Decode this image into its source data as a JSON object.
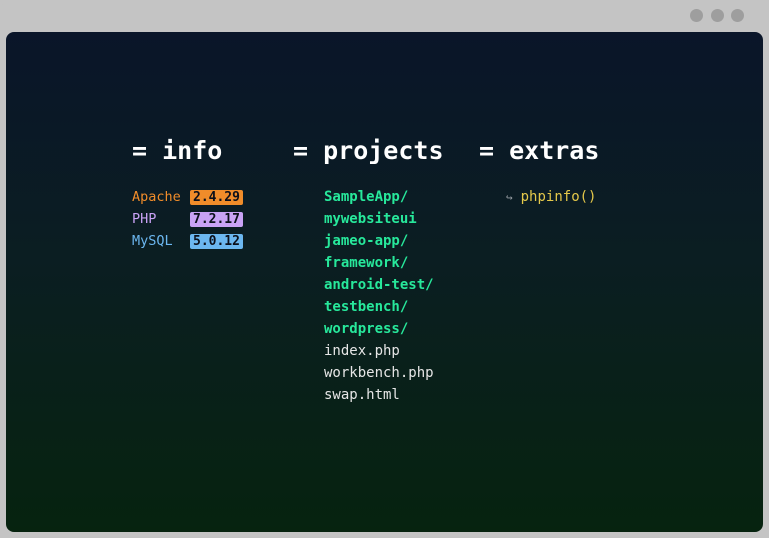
{
  "info": {
    "heading": "= info",
    "items": [
      {
        "name": "Apache",
        "version": "2.4.29",
        "color": "#f08c2a"
      },
      {
        "name": "PHP",
        "version": "7.2.17",
        "color": "#c9a2f5"
      },
      {
        "name": "MySQL",
        "version": "5.0.12",
        "color": "#6cb7f0"
      }
    ]
  },
  "projects": {
    "heading": "= projects",
    "folders": [
      "SampleApp/",
      "mywebsiteui",
      "jameo-app/",
      "framework/",
      "android-test/",
      "testbench/",
      "wordpress/"
    ],
    "files": [
      "index.php",
      "workbench.php",
      "swap.html"
    ]
  },
  "extras": {
    "heading": "= extras",
    "items": [
      {
        "arrow": "↪",
        "label": "phpinfo()"
      }
    ]
  },
  "colors": {
    "folder": "#27e89b",
    "file": "#e6e6e6",
    "extra": "#e4c84a",
    "background_top": "#0a1529",
    "background_bottom": "#06230f"
  }
}
